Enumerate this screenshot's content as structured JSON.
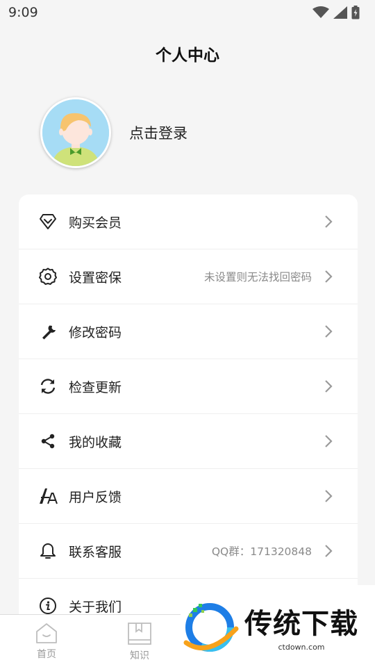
{
  "status_bar": {
    "time": "9:09"
  },
  "header": {
    "title": "个人中心"
  },
  "profile": {
    "login_label": "点击登录"
  },
  "menu": {
    "items": [
      {
        "label": "购买会员",
        "extra": "",
        "icon": "diamond-icon"
      },
      {
        "label": "设置密保",
        "extra": "未设置则无法找回密码",
        "icon": "gear-icon"
      },
      {
        "label": "修改密码",
        "extra": "",
        "icon": "wrench-icon"
      },
      {
        "label": "检查更新",
        "extra": "",
        "icon": "refresh-icon"
      },
      {
        "label": "我的收藏",
        "extra": "",
        "icon": "share-icon"
      },
      {
        "label": "用户反馈",
        "extra": "",
        "icon": "font-icon"
      },
      {
        "label": "联系客服",
        "extra": "QQ群：171320848",
        "icon": "bell-icon"
      },
      {
        "label": "关于我们",
        "extra": "",
        "icon": "info-icon"
      }
    ]
  },
  "tabs": [
    {
      "label": "首页",
      "icon": "home-icon"
    },
    {
      "label": "知识",
      "icon": "book-icon"
    }
  ],
  "watermark": {
    "title": "传统下载",
    "url": "ctdown.com"
  },
  "colors": {
    "background": "#f5f5f5",
    "card": "#ffffff",
    "text": "#222222",
    "muted": "#8a8a8a"
  }
}
